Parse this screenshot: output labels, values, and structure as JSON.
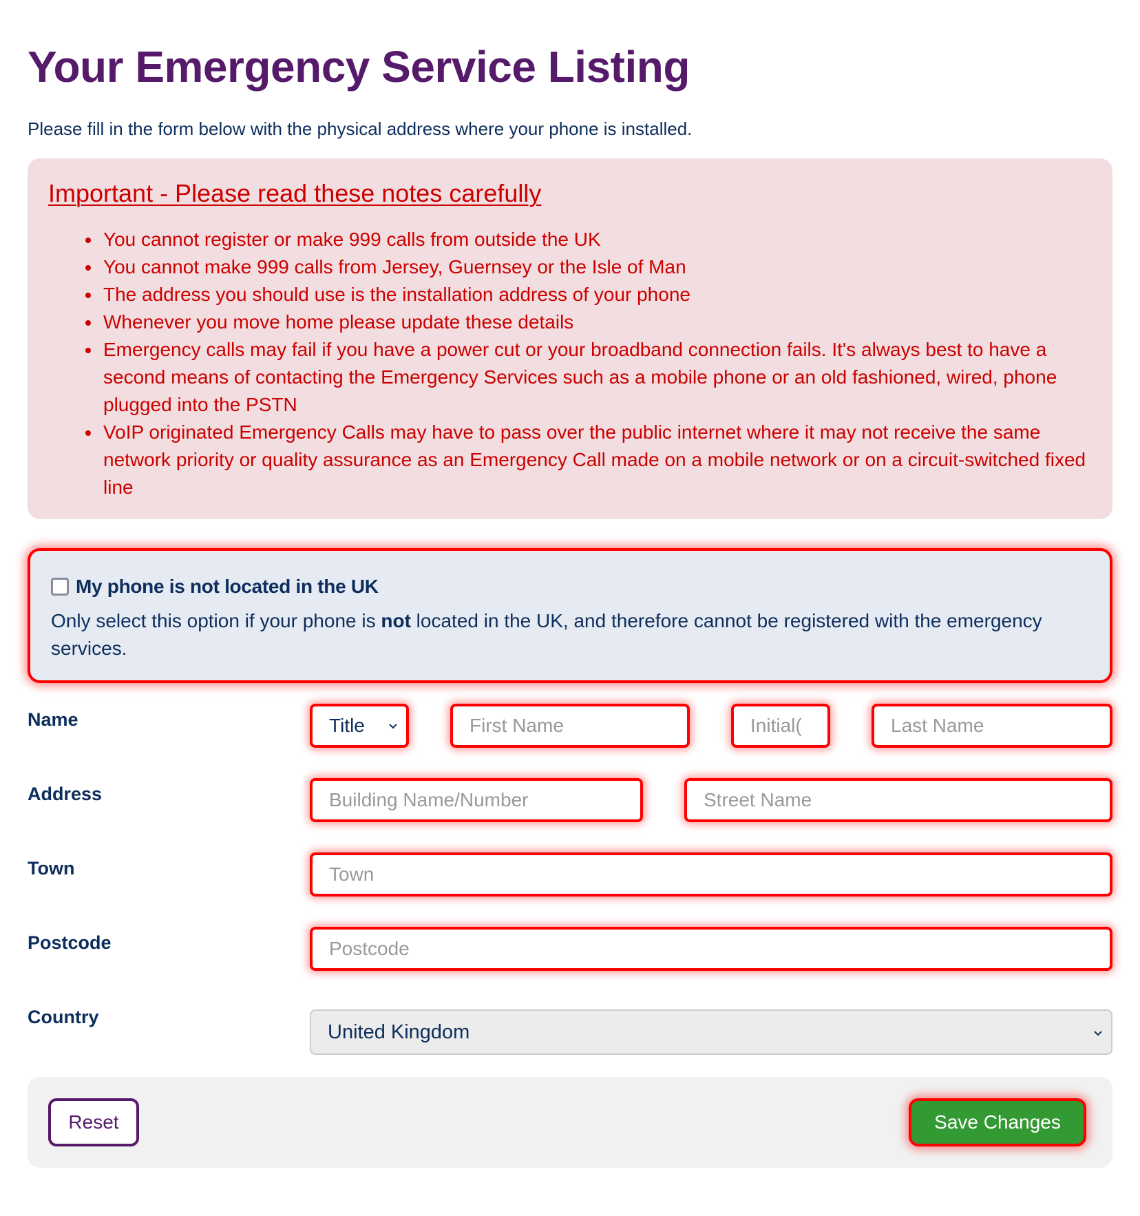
{
  "header": {
    "title": "Your Emergency Service Listing",
    "intro": "Please fill in the form below with the physical address where your phone is installed."
  },
  "notes": {
    "title": "Important - Please read these notes carefully",
    "items": [
      "You cannot register or make 999 calls from outside the UK",
      "You cannot make 999 calls from Jersey, Guernsey or the Isle of Man",
      "The address you should use is the installation address of your phone",
      "Whenever you move home please update these details",
      "Emergency calls may fail if you have a power cut or your broadband connection fails. It's always best to have a second means of contacting the Emergency Services such as a mobile phone or an old fashioned, wired, phone plugged into the PSTN",
      "VoIP originated Emergency Calls may have to pass over the public internet where it may not receive the same network priority or quality assurance as an Emergency Call made on a mobile network or on a circuit-switched fixed line"
    ],
    "color": "#cc0000",
    "background": "#f2dee0"
  },
  "not_in_uk": {
    "label": "My phone is not located in the UK",
    "checked": false,
    "desc_before": "Only select this option if your phone is ",
    "desc_bold": "not",
    "desc_after": " located in the UK, and therefore cannot be registered with the emergency services."
  },
  "form": {
    "name": {
      "label": "Name",
      "title_select": {
        "value": "Title"
      },
      "first_name": {
        "value": "",
        "placeholder": "First Name"
      },
      "initial": {
        "value": "",
        "placeholder": "Initial("
      },
      "last_name": {
        "value": "",
        "placeholder": "Last Name"
      }
    },
    "address": {
      "label": "Address",
      "building": {
        "value": "",
        "placeholder": "Building Name/Number"
      },
      "street": {
        "value": "",
        "placeholder": "Street Name"
      }
    },
    "town": {
      "label": "Town",
      "input": {
        "value": "",
        "placeholder": "Town"
      }
    },
    "postcode": {
      "label": "Postcode",
      "input": {
        "value": "",
        "placeholder": "Postcode"
      }
    },
    "country": {
      "label": "Country",
      "selected": "United Kingdom"
    },
    "error_border_color": "#ff0000"
  },
  "actions": {
    "reset_label": "Reset",
    "save_label": "Save Changes",
    "save_color": "#339933",
    "brand_color": "#561a6a"
  }
}
